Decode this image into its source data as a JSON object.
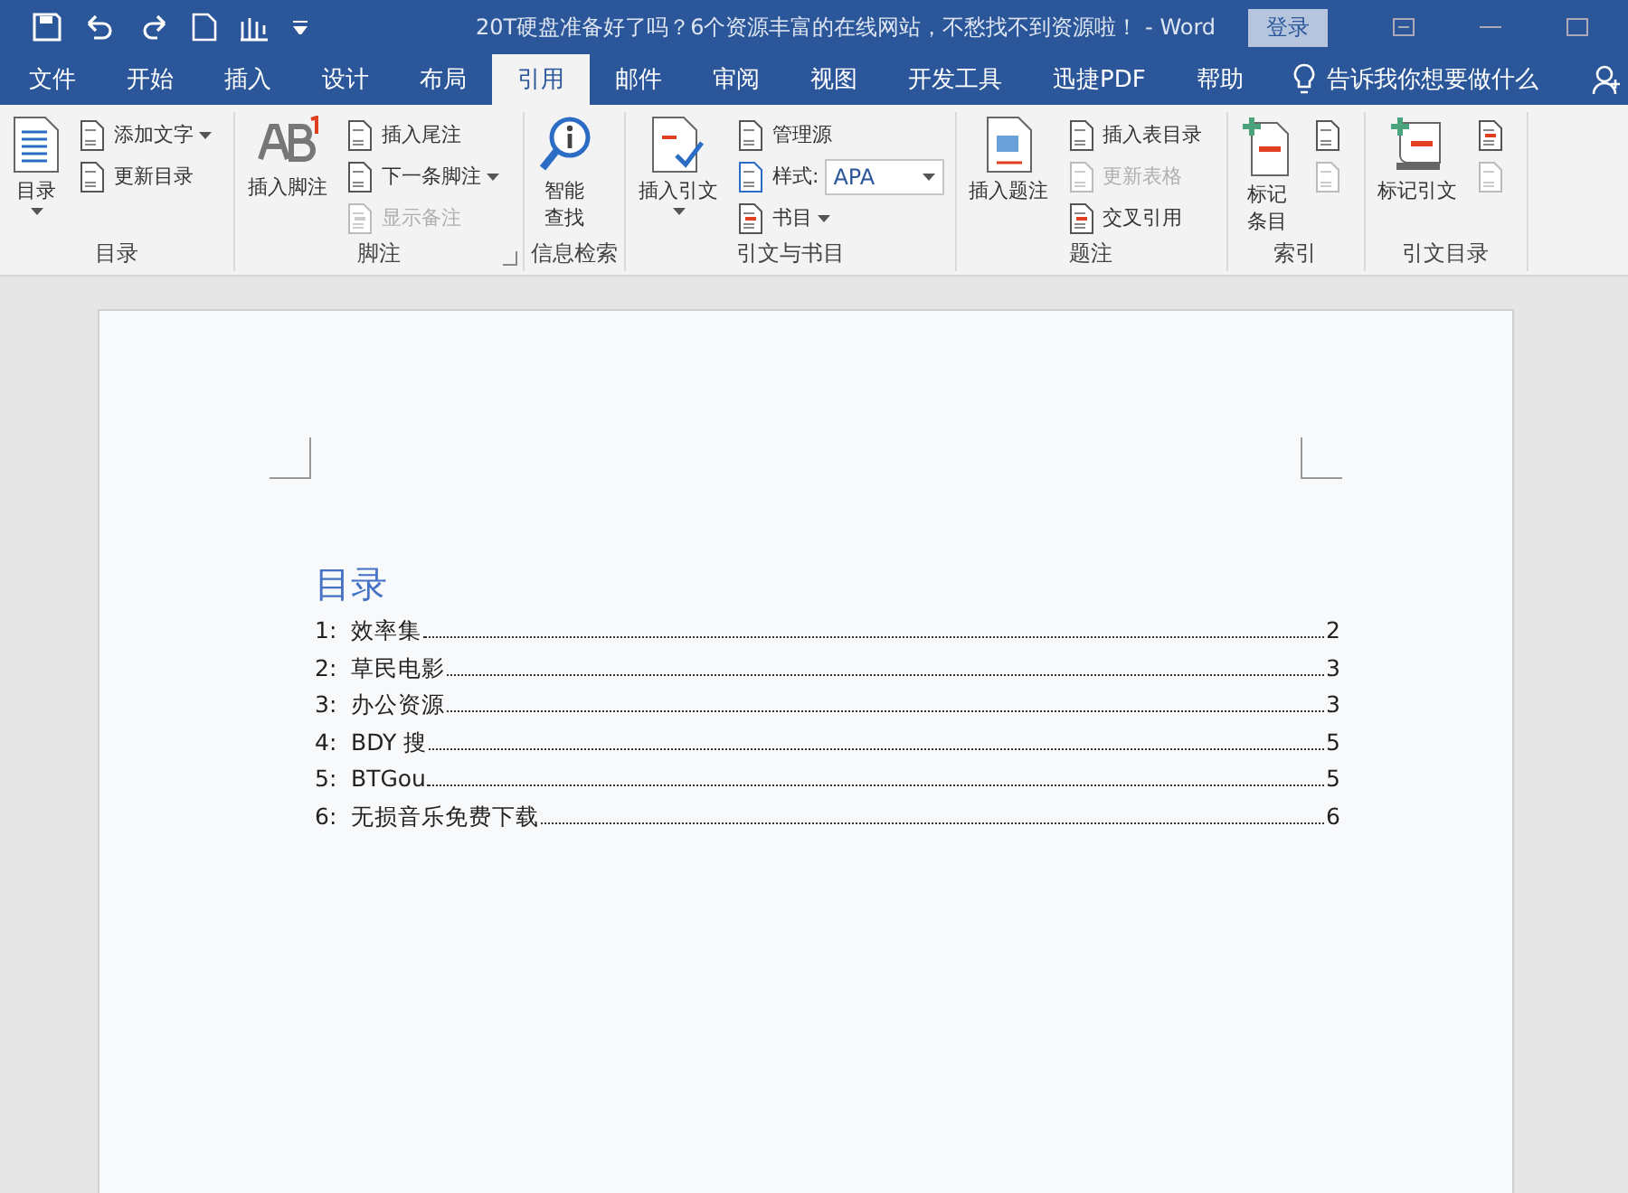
{
  "title_bar": {
    "title": "20T硬盘准备好了吗？6个资源丰富的在线网站，不愁找不到资源啦！  -  Word",
    "login": "登录"
  },
  "tabs": [
    {
      "label": "文件",
      "selected": false
    },
    {
      "label": "开始",
      "selected": false
    },
    {
      "label": "插入",
      "selected": false
    },
    {
      "label": "设计",
      "selected": false
    },
    {
      "label": "布局",
      "selected": false
    },
    {
      "label": "引用",
      "selected": true
    },
    {
      "label": "邮件",
      "selected": false
    },
    {
      "label": "审阅",
      "selected": false
    },
    {
      "label": "视图",
      "selected": false
    },
    {
      "label": "开发工具",
      "selected": false
    },
    {
      "label": "迅捷PDF",
      "selected": false
    },
    {
      "label": "帮助",
      "selected": false
    }
  ],
  "tell_me": "告诉我你想要做什么",
  "ribbon_groups": [
    {
      "label": "目录",
      "launcher": false,
      "large": {
        "label": "目录",
        "caret": true
      },
      "smalls": [
        {
          "kind": "button",
          "label": "添加文字",
          "dropdown": true,
          "disabled": false
        },
        {
          "kind": "button",
          "label": "更新目录",
          "dropdown": false,
          "disabled": false
        }
      ]
    },
    {
      "label": "脚注",
      "launcher": true,
      "large": {
        "label": "插入脚注",
        "caret": false
      },
      "smalls": [
        {
          "kind": "button",
          "label": "插入尾注",
          "dropdown": false,
          "disabled": false
        },
        {
          "kind": "button",
          "label": "下一条脚注",
          "dropdown": true,
          "disabled": false
        },
        {
          "kind": "button",
          "label": "显示备注",
          "dropdown": false,
          "disabled": true
        }
      ]
    },
    {
      "label": "信息检索",
      "launcher": false,
      "large": {
        "label": "智能查找",
        "caret": false
      }
    },
    {
      "label": "引文与书目",
      "launcher": false,
      "large": {
        "label": "插入引文",
        "caret": true
      },
      "smalls": [
        {
          "kind": "button",
          "label": "管理源",
          "dropdown": false,
          "disabled": false
        },
        {
          "kind": "select",
          "label": "样式:",
          "value": "APA",
          "disabled": false
        },
        {
          "kind": "button",
          "label": "书目",
          "dropdown": true,
          "disabled": false
        }
      ]
    },
    {
      "label": "题注",
      "launcher": false,
      "large": {
        "label": "插入题注",
        "caret": false
      },
      "smalls": [
        {
          "kind": "button",
          "label": "插入表目录",
          "dropdown": false,
          "disabled": false
        },
        {
          "kind": "button",
          "label": "更新表格",
          "dropdown": false,
          "disabled": true
        },
        {
          "kind": "button",
          "label": "交叉引用",
          "dropdown": false,
          "disabled": false
        }
      ]
    },
    {
      "label": "索引",
      "launcher": false,
      "large": {
        "label": "标记条目",
        "caret": false
      },
      "smalls": [
        {
          "kind": "icon",
          "disabled": false
        },
        {
          "kind": "icon",
          "disabled": true
        }
      ]
    },
    {
      "label": "引文目录",
      "launcher": false,
      "large": {
        "label": "标记引文",
        "caret": false
      },
      "smalls": [
        {
          "kind": "icon",
          "disabled": false
        },
        {
          "kind": "icon",
          "disabled": true
        }
      ]
    }
  ],
  "document": {
    "heading": "目录",
    "toc": [
      {
        "number": "1:",
        "title": "效率集",
        "page": "2"
      },
      {
        "number": "2:",
        "title": "草民电影",
        "page": "3"
      },
      {
        "number": "3:",
        "title": "办公资源",
        "page": "3"
      },
      {
        "number": "4:",
        "title": "BDY 搜",
        "page": "5"
      },
      {
        "number": "5:",
        "title": "BTGou",
        "page": "5"
      },
      {
        "number": "6:",
        "title": "无损音乐免费下载",
        "page": "6"
      }
    ]
  }
}
